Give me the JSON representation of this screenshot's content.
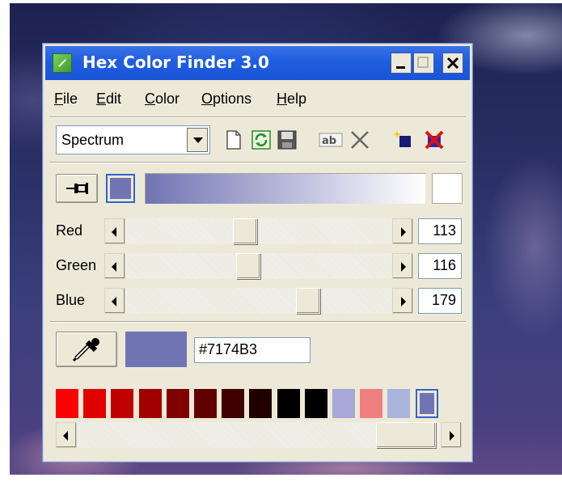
{
  "window": {
    "title": "Hex Color Finder 3.0"
  },
  "menu": [
    {
      "label": "File",
      "key": "F"
    },
    {
      "label": "Edit",
      "key": "E"
    },
    {
      "label": "Color",
      "key": "C"
    },
    {
      "label": "Options",
      "key": "O"
    },
    {
      "label": "Help",
      "key": "H"
    }
  ],
  "toolbar": {
    "palette_select": "Spectrum",
    "tools": [
      "new-file-icon",
      "refresh-icon",
      "save-icon",
      "rename-ab-icon",
      "delete-icon",
      "add-color-icon",
      "remove-color-icon"
    ]
  },
  "current_color": {
    "hex": "#7174B3",
    "swatch": "#7174b3"
  },
  "sliders": {
    "red": {
      "label": "Red",
      "value": "113",
      "fraction": 0.443
    },
    "green": {
      "label": "Green",
      "value": "116",
      "fraction": 0.455
    },
    "blue": {
      "label": "Blue",
      "value": "179",
      "fraction": 0.702
    }
  },
  "palette": [
    "#ff0000",
    "#e00000",
    "#c00000",
    "#a00000",
    "#800000",
    "#600000",
    "#400000",
    "#200000",
    "#000000",
    "#000000",
    "#a8a8d8",
    "#f08080",
    "#a8b4dc",
    "#7174b3"
  ],
  "palette_selected_index": 13
}
